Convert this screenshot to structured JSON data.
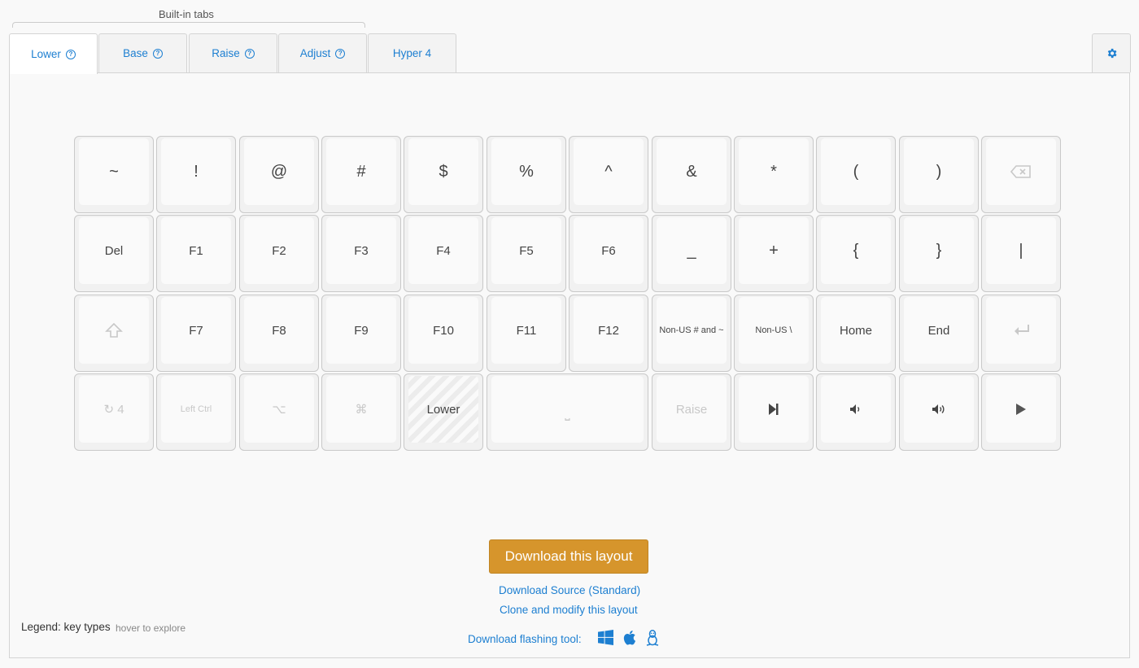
{
  "header": {
    "builtin_label": "Built-in tabs"
  },
  "tabs": [
    {
      "label": "Lower",
      "help": true,
      "active": true
    },
    {
      "label": "Base",
      "help": true,
      "active": false
    },
    {
      "label": "Raise",
      "help": true,
      "active": false
    },
    {
      "label": "Adjust",
      "help": true,
      "active": false
    },
    {
      "label": "Hyper 4",
      "help": false,
      "active": false
    }
  ],
  "settings": {
    "icon": "gear-icon"
  },
  "keyboard": {
    "rows": [
      [
        {
          "label": "~",
          "style": "big"
        },
        {
          "label": "!",
          "style": "big"
        },
        {
          "label": "@",
          "style": "big"
        },
        {
          "label": "#",
          "style": "big"
        },
        {
          "label": "$",
          "style": "big"
        },
        {
          "label": "%",
          "style": "big"
        },
        {
          "label": "^",
          "style": "big"
        },
        {
          "label": "&",
          "style": "big"
        },
        {
          "label": "*",
          "style": "big"
        },
        {
          "label": "(",
          "style": "big"
        },
        {
          "label": ")",
          "style": "big"
        },
        {
          "label": "",
          "icon": "backspace-icon",
          "style": "dim"
        }
      ],
      [
        {
          "label": "Del"
        },
        {
          "label": "F1"
        },
        {
          "label": "F2"
        },
        {
          "label": "F3"
        },
        {
          "label": "F4"
        },
        {
          "label": "F5"
        },
        {
          "label": "F6"
        },
        {
          "label": "_",
          "style": "big"
        },
        {
          "label": "+",
          "style": "big"
        },
        {
          "label": "{",
          "style": "big"
        },
        {
          "label": "}",
          "style": "big"
        },
        {
          "label": "|",
          "style": "big"
        }
      ],
      [
        {
          "label": "",
          "icon": "shift-icon",
          "style": "dim"
        },
        {
          "label": "F7"
        },
        {
          "label": "F8"
        },
        {
          "label": "F9"
        },
        {
          "label": "F10"
        },
        {
          "label": "F11"
        },
        {
          "label": "F12"
        },
        {
          "label": "Non-US # and ~",
          "style": "small"
        },
        {
          "label": "Non-US \\",
          "style": "small"
        },
        {
          "label": "Home"
        },
        {
          "label": "End"
        },
        {
          "label": "",
          "icon": "enter-icon",
          "style": "dim"
        }
      ],
      [
        {
          "label": "↻ 4",
          "style": "dim"
        },
        {
          "label": "Left Ctrl",
          "style": "dim-small"
        },
        {
          "label": "⌥",
          "style": "dim"
        },
        {
          "label": "⌘",
          "style": "dim"
        },
        {
          "label": "Lower",
          "style": "lower"
        },
        {
          "label": "⎵",
          "style": "dim",
          "wide": true
        },
        {
          "label": "Raise",
          "style": "dim"
        },
        {
          "label": "",
          "icon": "next-track-icon"
        },
        {
          "label": "",
          "icon": "volume-down-icon"
        },
        {
          "label": "",
          "icon": "volume-up-icon"
        },
        {
          "label": "",
          "icon": "play-icon"
        }
      ]
    ]
  },
  "actions": {
    "download_button": "Download this layout",
    "download_source": "Download Source (Standard)",
    "clone_modify": "Clone and modify this layout",
    "flashing_tool_label": "Download flashing tool:"
  },
  "legend": {
    "label": "Legend: key types",
    "hint": "hover to explore"
  },
  "colors": {
    "accent": "#1d7fd1",
    "download_button": "#d6952c"
  }
}
